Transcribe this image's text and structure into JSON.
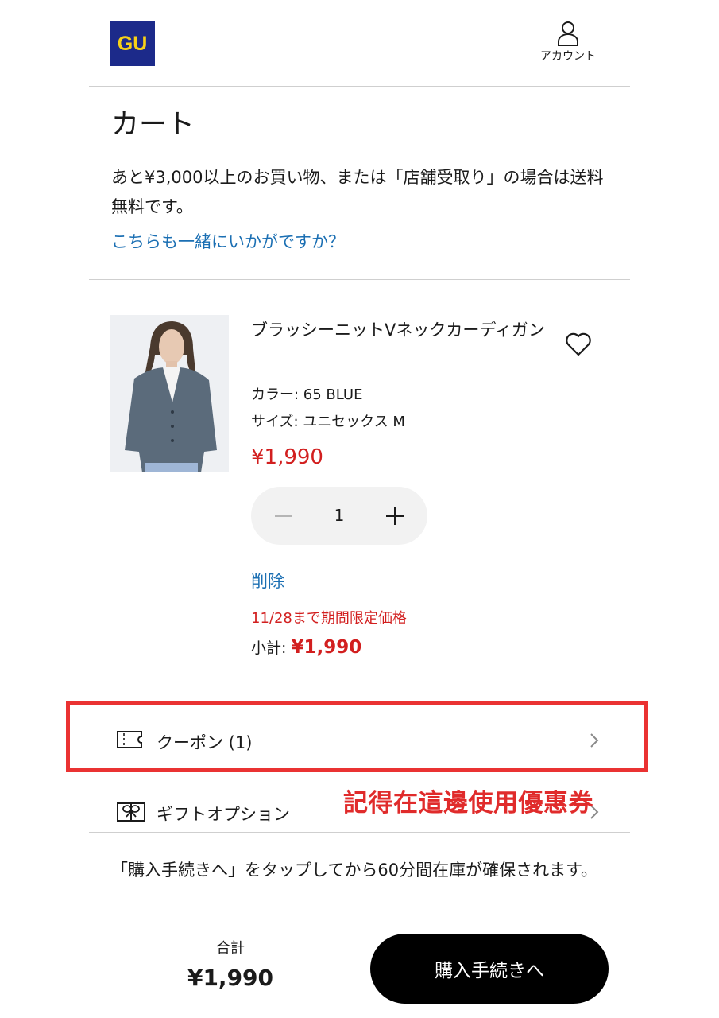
{
  "header": {
    "logo_text": "GU",
    "logo_colors": {
      "background": "#1c2a8a",
      "text": "#f7d117"
    },
    "account_label": "アカウント",
    "account_icon": "person-icon"
  },
  "page": {
    "title": "カート",
    "shipping_notice": "あと¥3,000以上のお買い物、または「店舗受取り」の場合は送料無料です。",
    "recommend_link": "こちらも一緒にいかがですか？"
  },
  "item": {
    "name": "ブラッシーニットVネックカーディガン",
    "color": "カラー: 65 BLUE",
    "size": "サイズ: ユニセックス M",
    "price": "¥1,990",
    "quantity": "1",
    "delete_label": "削除",
    "limited_offer": "11/28まで期間限定価格",
    "subtotal_label": "小計: ",
    "subtotal_value": "¥1,990",
    "favorite_icon": "heart-icon"
  },
  "options": {
    "coupon_label": "クーポン (1)",
    "coupon_icon": "ticket-icon",
    "gift_label": "ギフトオプション",
    "gift_icon": "gift-icon"
  },
  "annotation": {
    "text": "記得在這邊使用優惠券",
    "color": "#e02b2b"
  },
  "footer": {
    "reserve_notice": "「購入手続きへ」をタップしてから60分間在庫が確保されます。",
    "total_label": "合計",
    "total_value": "¥1,990",
    "checkout_label": "購入手続きへ"
  },
  "colors": {
    "link": "#1b6fb3",
    "price": "#d21f1f",
    "checkout_bg": "#000000"
  }
}
